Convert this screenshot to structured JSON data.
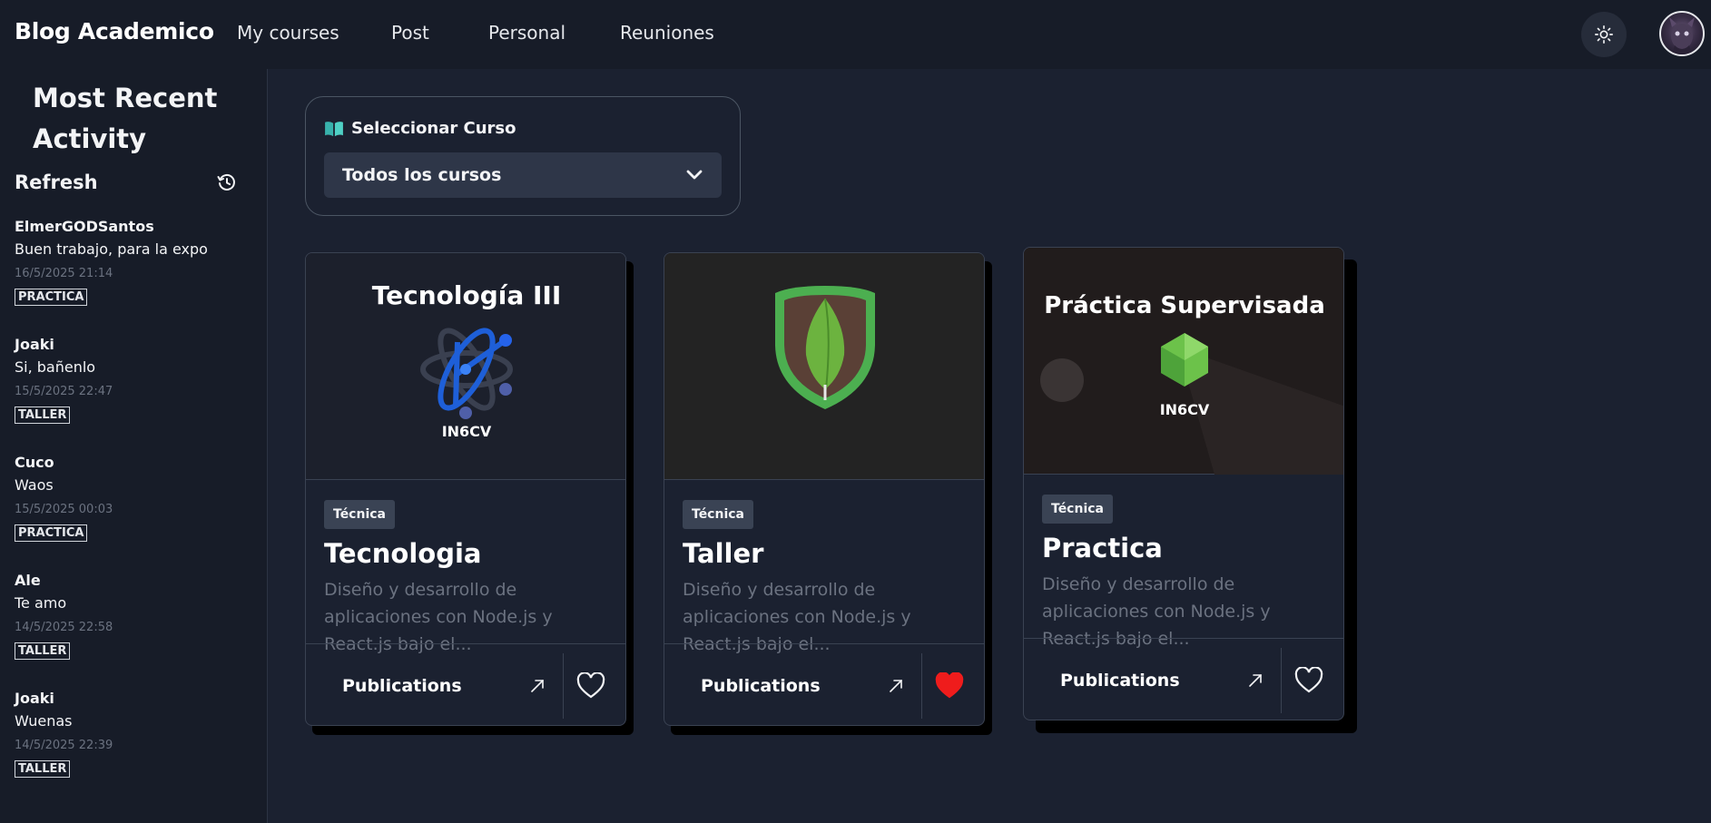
{
  "app": {
    "brand": "Blog Academico",
    "nav": [
      "My courses",
      "Post",
      "Personal",
      "Reuniones"
    ]
  },
  "sidebar": {
    "title": "Most Recent Activity",
    "refresh_label": "Refresh",
    "activities": [
      {
        "user": "ElmerGODSantos",
        "message": "Buen trabajo, para la expo",
        "date": "16/5/2025 21:14",
        "tag": "PRACTICA"
      },
      {
        "user": "Joaki",
        "message": "Si, bañenlo",
        "date": "15/5/2025 22:47",
        "tag": "TALLER"
      },
      {
        "user": "Cuco",
        "message": "Waos",
        "date": "15/5/2025 00:03",
        "tag": "PRACTICA"
      },
      {
        "user": "Ale",
        "message": "Te amo",
        "date": "14/5/2025 22:58",
        "tag": "TALLER"
      },
      {
        "user": "Joaki",
        "message": "Wuenas",
        "date": "14/5/2025 22:39",
        "tag": "TALLER"
      }
    ]
  },
  "selector": {
    "label": "Seleccionar Curso",
    "value": "Todos los cursos"
  },
  "courses": [
    {
      "image_title": "Tecnología III",
      "image_caption": "IN6CV",
      "badge": "Técnica",
      "title": "Tecnologia",
      "description": "Diseño y desarrollo de aplicaciones con Node.js y React.js bajo el...",
      "publications_label": "Publications",
      "liked": false
    },
    {
      "image_title": "",
      "image_caption": "",
      "badge": "Técnica",
      "title": "Taller",
      "description": "Diseño y desarrollo de aplicaciones con Node.js y React.js bajo el...",
      "publications_label": "Publications",
      "liked": true
    },
    {
      "image_title": "Práctica Supervisada",
      "image_caption": "IN6CV",
      "badge": "Técnica",
      "title": "Practica",
      "description": "Diseño y desarrollo de aplicaciones con Node.js y React.js bajo el...",
      "publications_label": "Publications",
      "liked": false
    }
  ],
  "colors": {
    "background": "#1b2130",
    "sidebar": "#171c28",
    "accent_heart": "#ef1c1c",
    "badge": "#3a4354",
    "muted_text": "#6b7280"
  },
  "icons": {
    "theme": "sun-icon",
    "refresh": "history-icon",
    "selector": "open-book-icon",
    "dropdown": "chevron-down-icon",
    "publications": "arrow-up-right-icon",
    "like": "heart-icon"
  }
}
